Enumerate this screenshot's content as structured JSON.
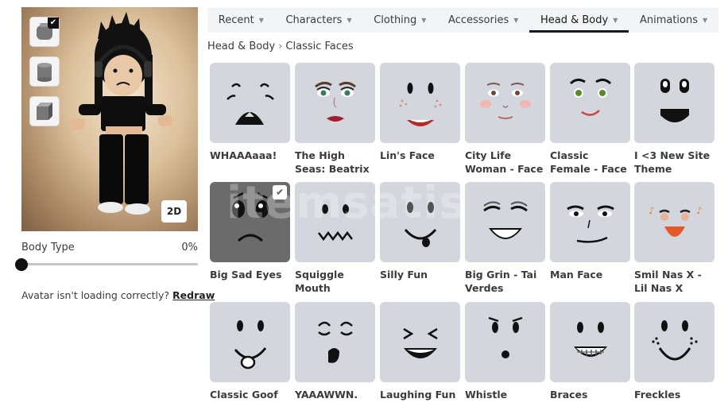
{
  "tabs": [
    {
      "label": "Recent",
      "active": false
    },
    {
      "label": "Characters",
      "active": false
    },
    {
      "label": "Clothing",
      "active": false
    },
    {
      "label": "Accessories",
      "active": false
    },
    {
      "label": "Head & Body",
      "active": true
    },
    {
      "label": "Animations",
      "active": false
    }
  ],
  "breadcrumb": {
    "parent": "Head & Body",
    "current": "Classic Faces"
  },
  "preview": {
    "thumbnails": [
      "head-classic-icon",
      "head-cylinder-icon",
      "head-block-icon"
    ],
    "selected_thumbnail": 0,
    "view_toggle_label": "2D"
  },
  "body_type": {
    "label": "Body Type",
    "value_text": "0%",
    "value": 0
  },
  "help": {
    "text": "Avatar isn't loading correctly?",
    "link": "Redraw"
  },
  "faces": [
    {
      "name": "WHAAAaaa!"
    },
    {
      "name": "The High Seas: Beatrix The..."
    },
    {
      "name": "Lin's Face"
    },
    {
      "name": "City Life Woman - Face"
    },
    {
      "name": "Classic Female - Face"
    },
    {
      "name": "I <3 New Site Theme"
    },
    {
      "name": "Big Sad Eyes",
      "selected": true
    },
    {
      "name": "Squiggle Mouth"
    },
    {
      "name": "Silly Fun"
    },
    {
      "name": "Big Grin - Tai Verdes"
    },
    {
      "name": "Man Face"
    },
    {
      "name": "Smil Nas X - Lil Nas X (LNX)"
    },
    {
      "name": "Classic Goof"
    },
    {
      "name": "YAAAWWN."
    },
    {
      "name": "Laughing Fun"
    },
    {
      "name": "Whistle"
    },
    {
      "name": "Braces"
    },
    {
      "name": "Freckles"
    }
  ]
}
